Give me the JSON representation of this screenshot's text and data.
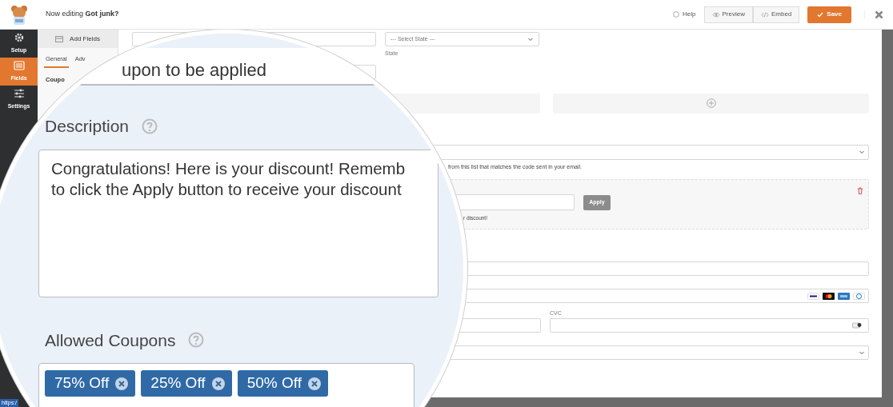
{
  "header": {
    "title_prefix": "Now editing",
    "form_name": "Got junk?",
    "help": "Help",
    "buttons": [
      {
        "kind": "preview",
        "label": "Preview"
      },
      {
        "kind": "embed",
        "label": "Embed"
      }
    ],
    "save": "Save"
  },
  "sidebar": {
    "items": [
      {
        "kind": "setup",
        "label": "Setup",
        "selected": false
      },
      {
        "kind": "fields",
        "label": "Fields",
        "selected": true
      },
      {
        "kind": "settings",
        "label": "Settings",
        "selected": false
      }
    ],
    "status_link": "https:/"
  },
  "panel": {
    "add_fields": "Add Fields",
    "tabs": [
      {
        "label": "General",
        "selected": true
      },
      {
        "label": "Adv",
        "selected": false
      }
    ],
    "field_label": "Coupo"
  },
  "preview": {
    "state_select": {
      "value": "--- Select State ---"
    },
    "state_label": "State",
    "coupon_help": "from this list that matches the code sent in your email.",
    "apply_button": "Apply",
    "coupon_note": "r discount!",
    "cvc_label": "CVC"
  },
  "magnifier": {
    "field_value": "upon to be applied",
    "description_label": "Description",
    "description_lines": [
      "Congratulations! Here is your discount! Rememb",
      "to click the Apply button to receive your discount"
    ],
    "allowed_label": "Allowed Coupons",
    "coupons": [
      "75% Off",
      "25% Off",
      "50% Off"
    ]
  }
}
